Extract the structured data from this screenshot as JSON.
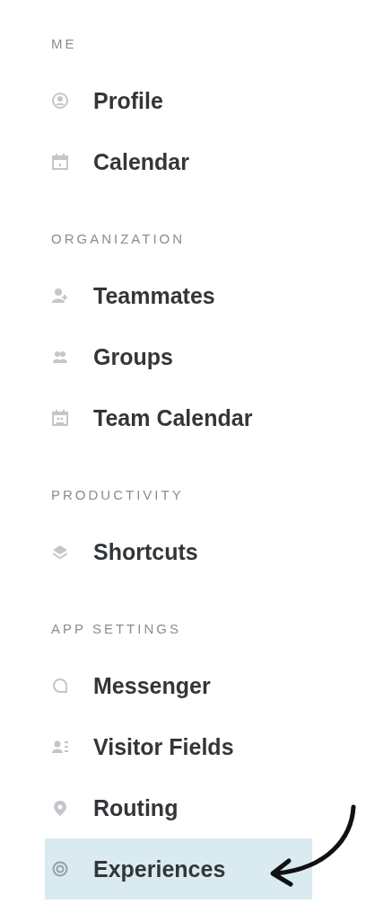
{
  "sections": [
    {
      "title": "ME",
      "items": [
        {
          "label": "Profile",
          "selected": false
        },
        {
          "label": "Calendar",
          "selected": false
        }
      ]
    },
    {
      "title": "ORGANIZATION",
      "items": [
        {
          "label": "Teammates",
          "selected": false
        },
        {
          "label": "Groups",
          "selected": false
        },
        {
          "label": "Team Calendar",
          "selected": false
        }
      ]
    },
    {
      "title": "PRODUCTIVITY",
      "items": [
        {
          "label": "Shortcuts",
          "selected": false
        }
      ]
    },
    {
      "title": "APP SETTINGS",
      "items": [
        {
          "label": "Messenger",
          "selected": false
        },
        {
          "label": "Visitor Fields",
          "selected": false
        },
        {
          "label": "Routing",
          "selected": false
        },
        {
          "label": "Experiences",
          "selected": true
        }
      ]
    }
  ]
}
